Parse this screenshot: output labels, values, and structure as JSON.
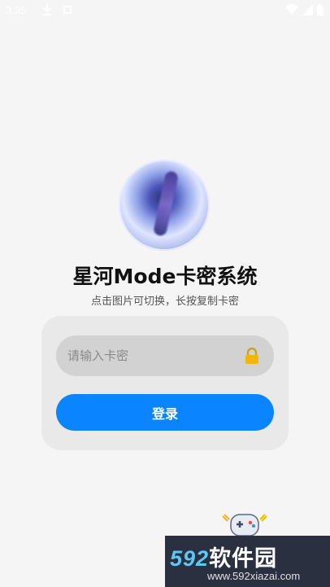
{
  "status_bar": {
    "time": "3:35",
    "icons": [
      "download-icon",
      "square-icon",
      "wifi-icon",
      "signal-icon",
      "battery-icon"
    ]
  },
  "header": {
    "title": "星河Mode卡密系统",
    "subtitle": "点击图片可切换，长按复制卡密"
  },
  "form": {
    "card_placeholder": "请输入卡密",
    "card_value": "",
    "login_label": "登录"
  },
  "watermark": {
    "brand_num": "592",
    "brand_text": "软件园",
    "url": "www.592xiazai.com"
  },
  "colors": {
    "accent": "#0a84ff",
    "background": "#f5f5f5",
    "card": "#e9e9e9",
    "input": "#d2d2d2"
  }
}
